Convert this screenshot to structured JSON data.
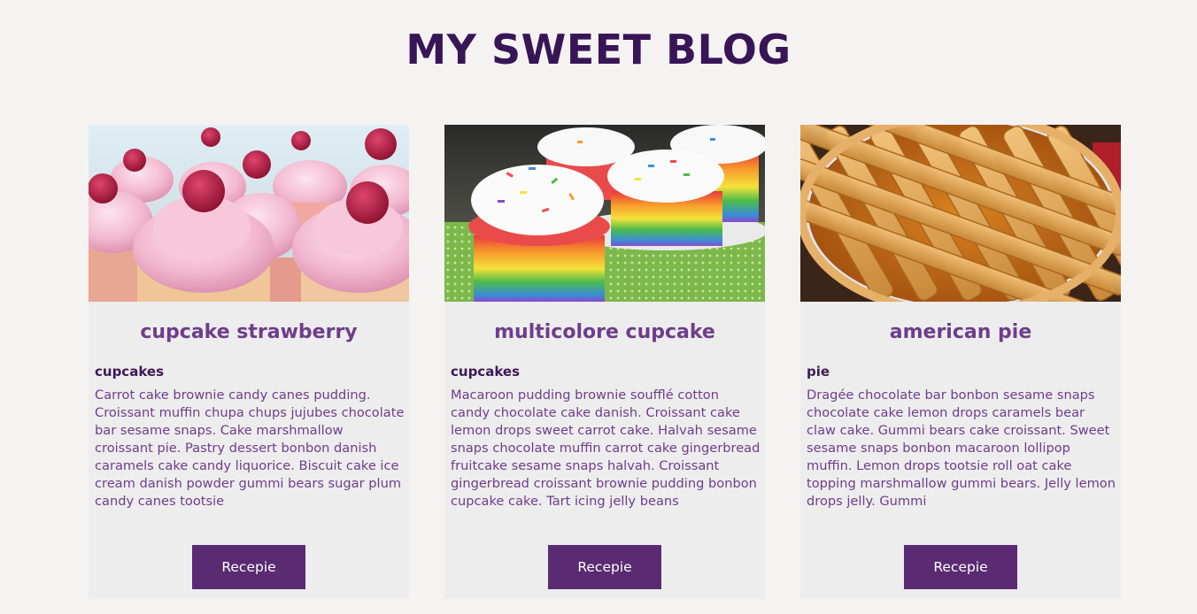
{
  "header": {
    "title": "MY SWEET BLOG"
  },
  "colors": {
    "background": "#f5f3f2",
    "title": "#381556",
    "card_background": "#ededed",
    "card_title": "#6e3d8b",
    "category": "#3d1a56",
    "button": "#5a2a73",
    "button_text": "#ffffff"
  },
  "posts": [
    {
      "image_alt": "cupcake-strawberry-photo",
      "title": "cupcake strawberry",
      "category": "cupcakes",
      "text": "Carrot cake brownie candy canes pudding. Croissant muffin chupa chups jujubes chocolate bar sesame snaps. Cake marshmallow croissant pie. Pastry dessert bonbon danish caramels cake candy liquorice. Biscuit cake ice cream danish powder gummi bears sugar plum candy canes tootsie",
      "button_label": "Recepie"
    },
    {
      "image_alt": "multicolore-cupcake-photo",
      "title": "multicolore cupcake",
      "category": "cupcakes",
      "text": "Macaroon pudding brownie soufflé cotton candy chocolate cake danish. Croissant cake lemon drops sweet carrot cake. Halvah sesame snaps chocolate muffin carrot cake gingerbread fruitcake sesame snaps halvah. Croissant gingerbread croissant brownie pudding bonbon cupcake cake. Tart icing jelly beans",
      "button_label": "Recepie"
    },
    {
      "image_alt": "american-pie-photo",
      "title": "american pie",
      "category": "pie",
      "text": "Dragée chocolate bar bonbon sesame snaps chocolate cake lemon drops caramels bear claw cake. Gummi bears cake croissant. Sweet sesame snaps bonbon macaroon lollipop muffin. Lemon drops tootsie roll oat cake topping marshmallow gummi bears. Jelly lemon drops jelly. Gummi",
      "button_label": "Recepie"
    }
  ]
}
